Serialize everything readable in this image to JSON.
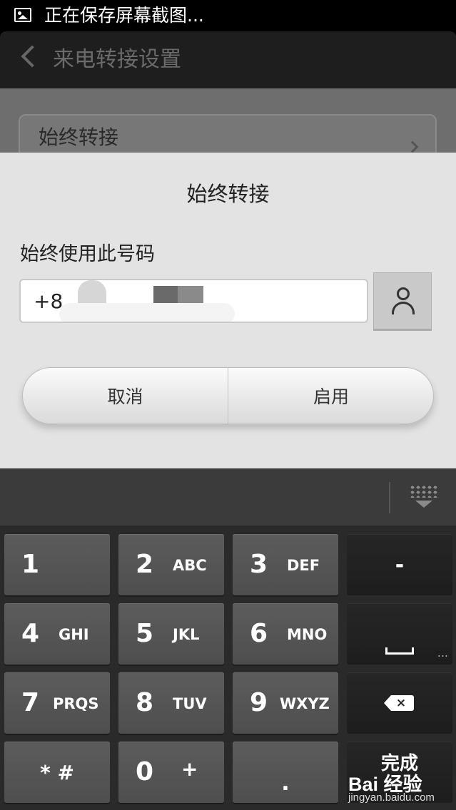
{
  "status_bar": {
    "notification_icon": "image-icon",
    "text": "正在保存屏幕截图..."
  },
  "app_bar": {
    "title": "来电转接设置",
    "back_icon": "chevron-left-icon"
  },
  "background_list": {
    "items": [
      {
        "label": "始终转接"
      }
    ]
  },
  "dialog": {
    "title": "始终转接",
    "field_label": "始终使用此号码",
    "phone_value": "+8",
    "contact_icon": "person-icon",
    "cancel_label": "取消",
    "enable_label": "启用"
  },
  "keyboard": {
    "hide_icon": "keyboard-hide-icon",
    "keys": [
      {
        "digit": "1",
        "letters": ""
      },
      {
        "digit": "2",
        "letters": "ABC"
      },
      {
        "digit": "3",
        "letters": "DEF"
      },
      {
        "symbol": "-"
      },
      {
        "digit": "4",
        "letters": "GHI"
      },
      {
        "digit": "5",
        "letters": "JKL"
      },
      {
        "digit": "6",
        "letters": "MNO"
      },
      {
        "symbol": "space"
      },
      {
        "digit": "7",
        "letters": "PRQS"
      },
      {
        "digit": "8",
        "letters": "TUV"
      },
      {
        "digit": "9",
        "letters": "WXYZ"
      },
      {
        "symbol": "backspace"
      },
      {
        "symbol": "* #"
      },
      {
        "digit": "0",
        "letters": "+"
      },
      {
        "symbol": "."
      },
      {
        "symbol": "完成"
      }
    ],
    "more_dots": "..."
  },
  "watermark": {
    "logo": "Bai 经验",
    "url": "jingyan.baidu.com"
  }
}
